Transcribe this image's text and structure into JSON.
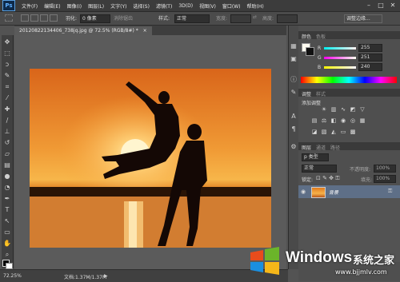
{
  "app": {
    "logo": "Ps"
  },
  "menu": {
    "items": [
      "文件(F)",
      "编辑(E)",
      "图像(I)",
      "图层(L)",
      "文字(Y)",
      "选择(S)",
      "滤镜(T)",
      "3D(D)",
      "视图(V)",
      "窗口(W)",
      "帮助(H)"
    ],
    "window_controls": [
      "–",
      "□",
      "✕"
    ]
  },
  "options": {
    "feather_label": "羽化:",
    "feather_value": "0 像素",
    "antialias_label": "消除锯齿",
    "style_label": "样式:",
    "style_value": "正常",
    "width_label": "宽度:",
    "height_label": "高度:",
    "refine_edge": "调整边缘..."
  },
  "document": {
    "tab_title": "20120822134406_738jq.jpg @ 72.5% (RGB/8#) *",
    "tab_close": "×"
  },
  "status": {
    "zoom": "72.25%",
    "doc": "文档:1.37M/1.37M",
    "arrow": "▶"
  },
  "color_panel": {
    "tabs": [
      "颜色",
      "色板"
    ],
    "r_label": "R",
    "g_label": "G",
    "b_label": "B",
    "r_value": "255",
    "g_value": "251",
    "b_value": "240"
  },
  "adjust_panel": {
    "tabs": [
      "调整",
      "样式"
    ],
    "add_label": "添加调整"
  },
  "layers_panel": {
    "tabs": [
      "图层",
      "通道",
      "路径"
    ],
    "kind_label": "p 类型",
    "blend_mode": "正常",
    "opacity_label": "不透明度:",
    "opacity_value": "100%",
    "lock_label": "锁定:",
    "fill_label": "填充:",
    "fill_value": "100%",
    "layer_name": "背景"
  },
  "watermark": {
    "brand": "Windows",
    "suffix": "系统之家",
    "url": "www.bjjmlv.com"
  },
  "colors": {
    "accent": "#5e6f87",
    "sky_top": "#e07a1e",
    "sky_mid": "#f4a43a",
    "sun": "#fff1c0"
  },
  "icons": [
    "marquee-icon",
    "move-icon",
    "lasso-icon",
    "crop-icon",
    "eyedropper-icon",
    "brush-icon",
    "eraser-icon",
    "pen-icon",
    "text-icon",
    "hand-icon",
    "zoom-icon",
    "eye-icon",
    "lock-icon",
    "windows-logo-icon"
  ]
}
